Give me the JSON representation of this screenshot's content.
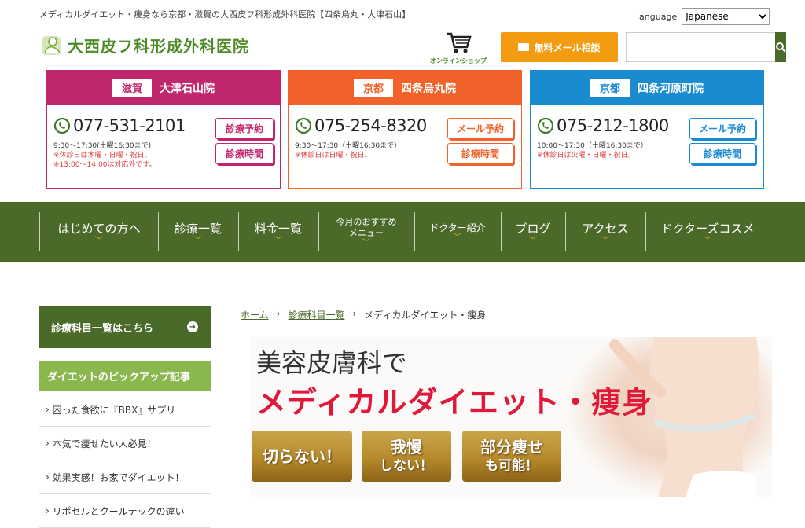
{
  "header": {
    "tagline": "メディカルダイエット・痩身なら京都・滋賀の大西皮フ科形成外科医院【四条烏丸・大津石山】",
    "language_label": "language",
    "language_value": "Japanese",
    "logo_text": "大西皮フ科形成外科医院",
    "shop_label": "オンラインショップ",
    "mail_button": "無料メール相談",
    "search_placeholder": ""
  },
  "clinics": [
    {
      "pref": "滋賀",
      "name": "大津石山院",
      "phone": "077-531-2101",
      "hours": "9:30〜17:30(土曜16:30まで)",
      "note1": "※休診日は木曜・日曜・祝日。",
      "note2": "※13:00〜14:00は対応外です。",
      "btn1": "診療予約",
      "btn2": "診療時間",
      "color": "#c0266c"
    },
    {
      "pref": "京都",
      "name": "四条烏丸院",
      "phone": "075-254-8320",
      "hours": "9:30〜17:30（土曜16:30まで）",
      "note1": "※休診日は日曜・祝日。",
      "note2": "",
      "btn1": "メール予約",
      "btn2": "診療時間",
      "color": "#f0622a"
    },
    {
      "pref": "京都",
      "name": "四条河原町院",
      "phone": "075-212-1800",
      "hours": "10:00〜17:30（土曜16:30まで）",
      "note1": "※休診日は火曜・日曜・祝日。",
      "note2": "",
      "btn1": "メール予約",
      "btn2": "診療時間",
      "color": "#1a8bd0"
    }
  ],
  "nav": [
    {
      "label": "はじめての方へ"
    },
    {
      "label": "診療一覧"
    },
    {
      "label": "料金一覧"
    },
    {
      "label": "今月のおすすめ\nメニュー"
    },
    {
      "label": "ドクター紹介"
    },
    {
      "label": "ブログ"
    },
    {
      "label": "アクセス"
    },
    {
      "label": "ドクターズコスメ"
    }
  ],
  "sidebar": {
    "main_link": "診療科目一覧はこちら",
    "pickup_title": "ダイエットのピックアップ記事",
    "items": [
      "困った食欲に『BBX』サプリ",
      "本気で痩せたい人必見！",
      "効果実感！お家でダイエット！",
      "リポセルとクールテックの違い"
    ]
  },
  "breadcrumb": {
    "home": "ホーム",
    "list": "診療科目一覧",
    "current": "メディカルダイエット・痩身"
  },
  "hero": {
    "line1": "美容皮膚科で",
    "line2": "メディカルダイエット・痩身",
    "badge1": "切らない！",
    "badge2a": "我慢",
    "badge2b": "しない！",
    "badge3a": "部分痩せ",
    "badge3b": "も可能！"
  },
  "colors": {
    "brand_green": "#4b6a2a",
    "light_green": "#8ab84e",
    "orange": "#f39c12",
    "hero_red": "#e0193a"
  }
}
